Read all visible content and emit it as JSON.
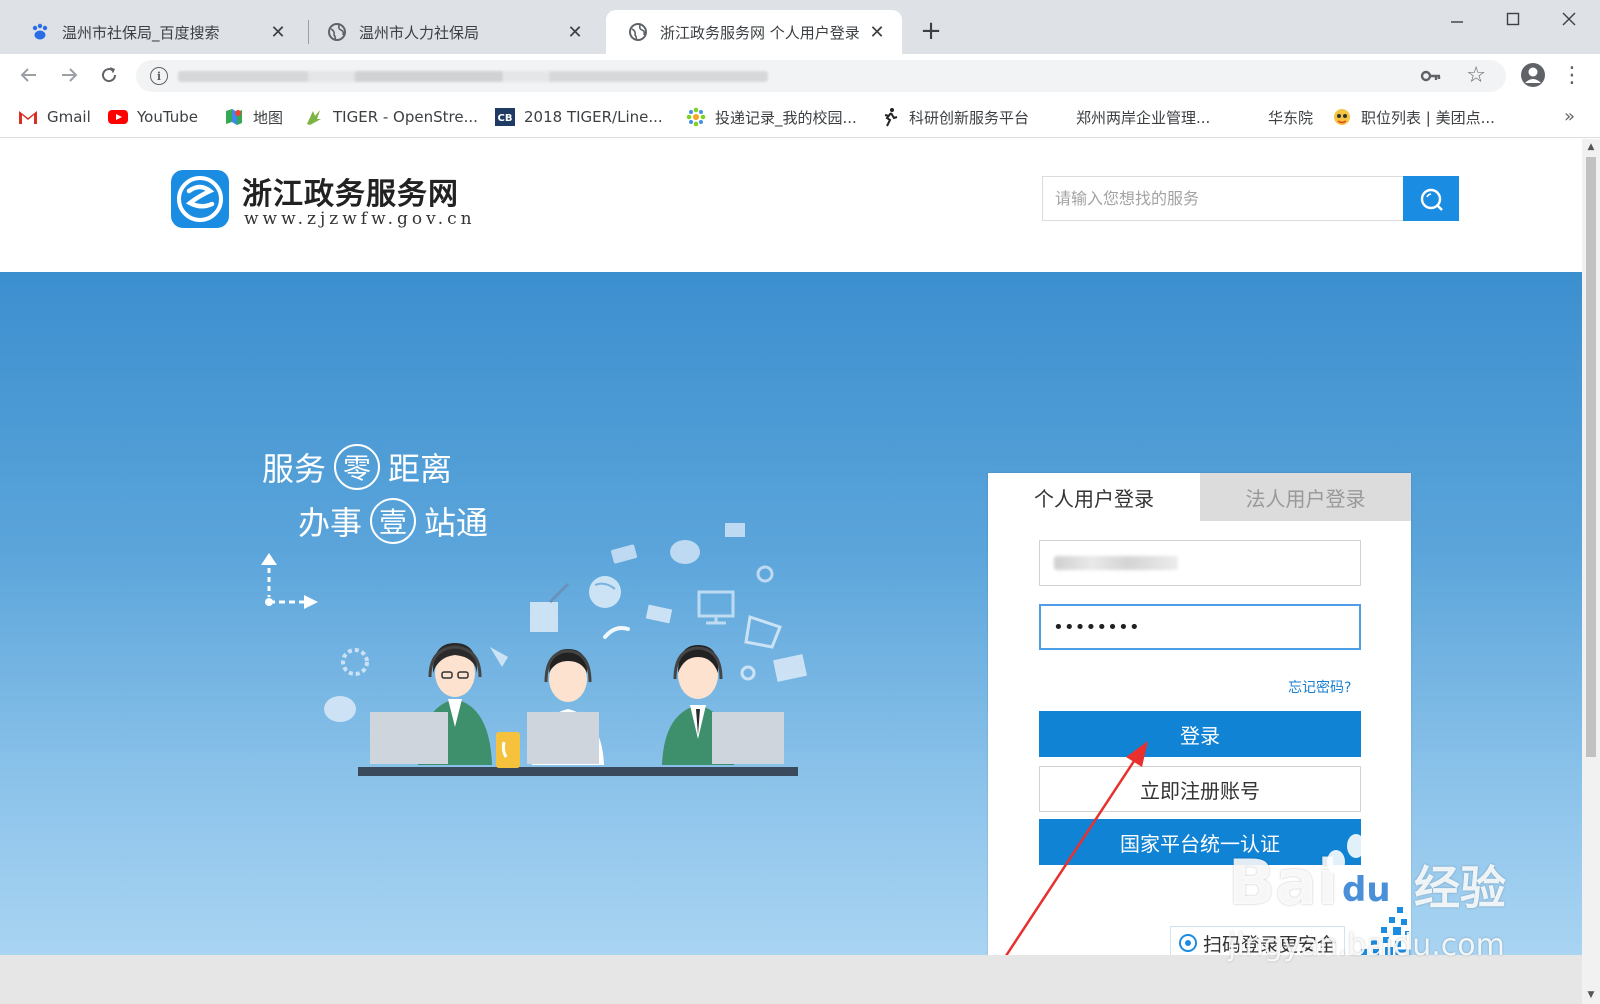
{
  "tabs": [
    {
      "title": "温州市社保局_百度搜索",
      "icon": "baidu-paw-icon",
      "active": false
    },
    {
      "title": "温州市人力社保局",
      "icon": "globe-icon",
      "active": false
    },
    {
      "title": "浙江政务服务网 个人用户登录",
      "icon": "globe-icon",
      "active": true
    }
  ],
  "bookmarks": [
    {
      "label": "Gmail",
      "icon": "gmail-icon"
    },
    {
      "label": "YouTube",
      "icon": "youtube-icon"
    },
    {
      "label": "地图",
      "icon": "maps-icon"
    },
    {
      "label": "TIGER - OpenStre...",
      "icon": "tiger-icon"
    },
    {
      "label": "2018 TIGER/Line...",
      "icon": "cb-icon"
    },
    {
      "label": "投递记录_我的校园...",
      "icon": "gear-flower-icon"
    },
    {
      "label": "科研创新服务平台",
      "icon": "runner-icon"
    },
    {
      "label": "郑州两岸企业管理...",
      "icon": ""
    },
    {
      "label": "华东院",
      "icon": ""
    },
    {
      "label": "职位列表 | 美团点...",
      "icon": "meituan-icon"
    }
  ],
  "bookmarks_more": "»",
  "site": {
    "name": "浙江政务服务网",
    "url": "www.zjzwfw.gov.cn",
    "search_placeholder": "请输入您想找的服务"
  },
  "hero": {
    "slogan1_a": "服务",
    "slogan1_circle": "零",
    "slogan1_b": "距离",
    "slogan2_a": "办事",
    "slogan2_circle": "壹",
    "slogan2_b": "站通"
  },
  "login": {
    "tab_personal": "个人用户登录",
    "tab_corporate": "法人用户登录",
    "password_value": "••••••••",
    "forgot": "忘记密码?",
    "login_button": "登录",
    "register_button": "立即注册账号",
    "national_button": "国家平台统一认证",
    "qr_hint": "扫码登录更安全"
  },
  "watermark": {
    "brand": "Bai",
    "brand_paw": "du",
    "brand_cn": "经验",
    "url": "jingyan.baidu.com"
  },
  "colors": {
    "primary": "#1183d5",
    "search_button": "#1a8de3",
    "annotation_arrow": "#e8312f"
  }
}
